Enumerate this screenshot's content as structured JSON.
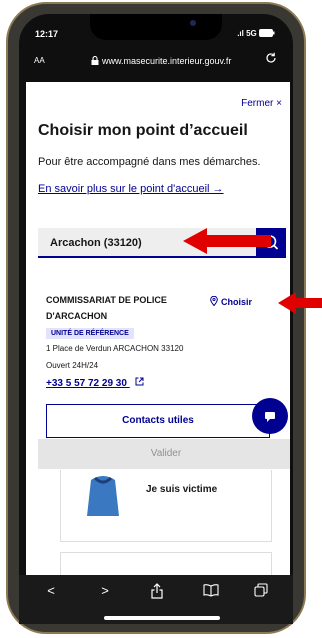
{
  "status": {
    "time": "12:17",
    "network": "5G"
  },
  "browser": {
    "text_size_label": "AA",
    "url": "www.masecurite.interieur.gouv.fr"
  },
  "dialog": {
    "close_label": "Fermer",
    "title": "Choisir mon point d’accueil",
    "description": "Pour être accompagné dans mes démarches.",
    "learn_more": "En savoir plus sur le point d'accueil"
  },
  "search": {
    "value": "Arcachon (33120)"
  },
  "result": {
    "name_line1": "COMMISSARIAT DE POLICE",
    "name_line2": "D'ARCACHON",
    "choose_label": "Choisir",
    "badge": "UNITÉ DE RÉFÉRENCE",
    "address": "1 Place de Verdun ARCACHON 33120",
    "hours": "Ouvert 24H/24",
    "phone": "+33 5 57 72 29 30"
  },
  "buttons": {
    "contacts": "Contacts utiles",
    "validate": "Valider"
  },
  "background_cards": {
    "victim": "Je suis victime"
  },
  "colors": {
    "primary": "#000091",
    "annotation_arrow": "#e00000",
    "badge_bg": "#e3e3fd",
    "disabled_bg": "#e5e5e5",
    "phone_frame": "#8d7a55"
  },
  "icons": {
    "lock": "lock-icon",
    "reload": "reload-icon",
    "search": "search-icon",
    "location": "location-pin-icon",
    "external": "external-link-icon",
    "chat": "chat-icon"
  }
}
